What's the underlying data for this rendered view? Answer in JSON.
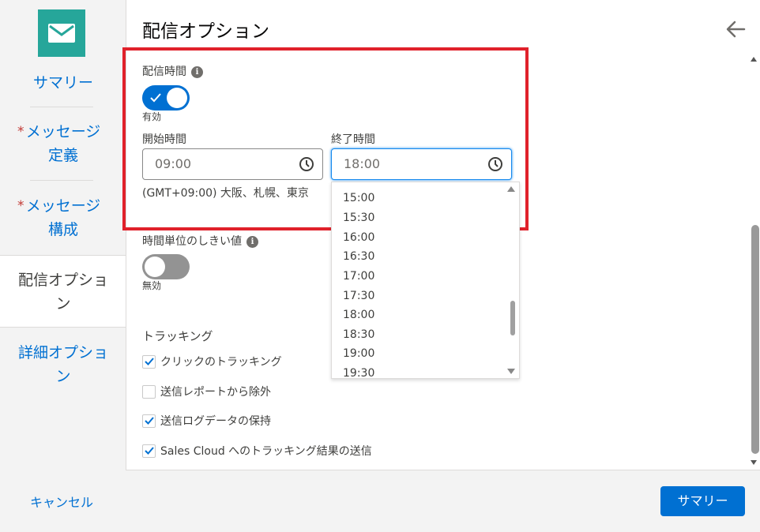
{
  "sidebar": {
    "summary": "サマリー",
    "message_def": [
      "メッセージ",
      "定義"
    ],
    "message_comp": [
      "メッセージ",
      "構成"
    ],
    "required_mark": "*",
    "delivery_options": [
      "配信オプショ",
      "ン"
    ],
    "advanced_options": [
      "詳細オプショ",
      "ン"
    ]
  },
  "main": {
    "title": "配信オプション",
    "delivery_time": {
      "label": "配信時間",
      "info": "i",
      "toggle_state": "on",
      "toggle_text": "有効",
      "start_label": "開始時間",
      "start_value": "09:00",
      "end_label": "終了時間",
      "end_value": "18:00",
      "timezone": "(GMT+09:00) 大阪、札幌、東京"
    },
    "dropdown_times": [
      "15:00",
      "15:30",
      "16:00",
      "16:30",
      "17:00",
      "17:30",
      "18:00",
      "18:30",
      "19:00",
      "19:30"
    ],
    "threshold": {
      "label": "時間単位のしきい値",
      "info": "i",
      "toggle_state": "off",
      "toggle_text": "無効"
    },
    "tracking": {
      "title": "トラッキング",
      "options": [
        {
          "label": "クリックのトラッキング",
          "checked": true
        },
        {
          "label": "送信レポートから除外",
          "checked": false
        },
        {
          "label": "送信ログデータの保持",
          "checked": true
        },
        {
          "label": "Sales Cloud へのトラッキング結果の送信",
          "checked": true
        }
      ]
    }
  },
  "footer": {
    "cancel": "キャンセル",
    "summary_button": "サマリー"
  },
  "colors": {
    "accent": "#0070d2",
    "mail_tile": "#26a69a",
    "highlight": "#e0212b"
  },
  "icons": {
    "mail": "mail-icon",
    "back": "back-arrow-icon",
    "clock": "clock-icon",
    "info": "info-icon",
    "check": "check-icon"
  }
}
